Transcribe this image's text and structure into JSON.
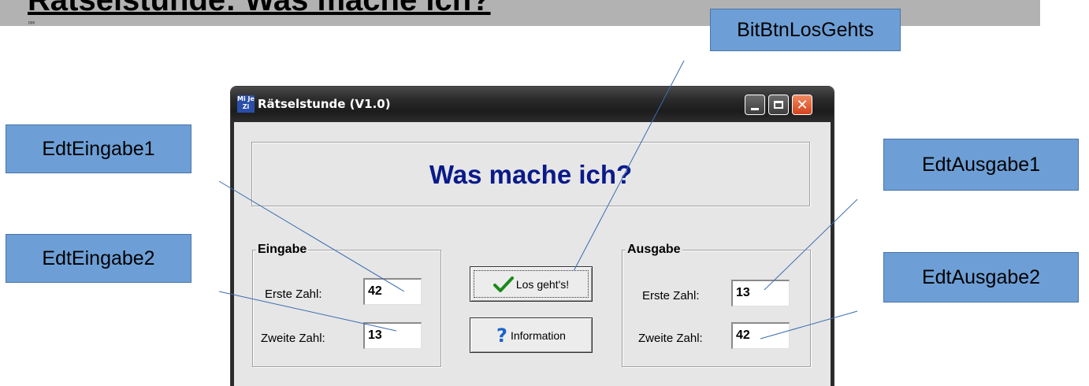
{
  "slide": {
    "title": "Rätselstunde: Was mache ich?",
    "tiny_text": "ppp"
  },
  "callouts": {
    "bit_btn_los_gehts": "BitBtnLosGehts",
    "edt_eingabe1": "EdtEingabe1",
    "edt_eingabe2": "EdtEingabe2",
    "edt_ausgabe1": "EdtAusgabe1",
    "edt_ausgabe2": "EdtAusgabe2"
  },
  "window": {
    "title": "Rätselstunde (V1.0)",
    "icon_text": "Mi Je Zi",
    "heading": "Was mache ich?",
    "close_glyph": "✕"
  },
  "eingabe": {
    "legend": "Eingabe",
    "label_first": "Erste Zahl:",
    "label_second": "Zweite Zahl:",
    "value_first": "42",
    "value_second": "13"
  },
  "ausgabe": {
    "legend": "Ausgabe",
    "label_first": "Erste Zahl:",
    "label_second": "Zweite Zahl:",
    "value_first": "13",
    "value_second": "42"
  },
  "buttons": {
    "los_gehts": "Los geht's!",
    "information": "Information",
    "info_glyph": "?"
  },
  "colors": {
    "callout_fill": "#6d9fd6",
    "heading_text": "#0a1a8a",
    "banner": "#b2b2b2"
  }
}
